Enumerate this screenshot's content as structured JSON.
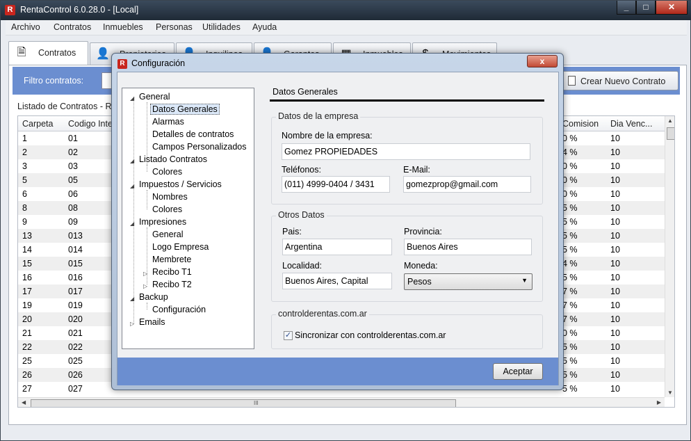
{
  "window": {
    "title": "RentaControl 6.0.28.0 - [Local]",
    "app_icon": "R"
  },
  "menu": [
    "Archivo",
    "Contratos",
    "Inmuebles",
    "Personas",
    "Utilidades",
    "Ayuda"
  ],
  "tabs": [
    {
      "label": "Contratos",
      "icon": "document-icon"
    },
    {
      "label": "Propietarios",
      "icon": "person-icon"
    },
    {
      "label": "Inquilinos",
      "icon": "person-icon"
    },
    {
      "label": "Garantes",
      "icon": "person-icon"
    },
    {
      "label": "Inmuebles",
      "icon": "building-icon"
    },
    {
      "label": "Movimientos",
      "icon": "money-icon"
    }
  ],
  "filter": {
    "label": "Filtro contratos:",
    "create_button": "Crear Nuevo Contrato"
  },
  "list": {
    "title": "Listado de Contratos - R",
    "columns": {
      "carpeta": "Carpeta",
      "codigo": "Codigo Inte",
      "comision": "Comision",
      "dia": "Dia Venc..."
    },
    "rows": [
      {
        "carpeta": "1",
        "codigo": "01",
        "comision": "0 %",
        "dia": "10"
      },
      {
        "carpeta": "2",
        "codigo": "02",
        "comision": "4 %",
        "dia": "10"
      },
      {
        "carpeta": "3",
        "codigo": "03",
        "comision": "0 %",
        "dia": "10"
      },
      {
        "carpeta": "5",
        "codigo": "05",
        "comision": "0 %",
        "dia": "10"
      },
      {
        "carpeta": "6",
        "codigo": "06",
        "comision": "0 %",
        "dia": "10"
      },
      {
        "carpeta": "8",
        "codigo": "08",
        "comision": "5 %",
        "dia": "10"
      },
      {
        "carpeta": "9",
        "codigo": "09",
        "comision": "5 %",
        "dia": "10"
      },
      {
        "carpeta": "13",
        "codigo": "013",
        "comision": "5 %",
        "dia": "10"
      },
      {
        "carpeta": "14",
        "codigo": "014",
        "comision": "5 %",
        "dia": "10"
      },
      {
        "carpeta": "15",
        "codigo": "015",
        "comision": "4 %",
        "dia": "10"
      },
      {
        "carpeta": "16",
        "codigo": "016",
        "comision": "5 %",
        "dia": "10"
      },
      {
        "carpeta": "17",
        "codigo": "017",
        "comision": "7 %",
        "dia": "10"
      },
      {
        "carpeta": "19",
        "codigo": "019",
        "comision": "7 %",
        "dia": "10"
      },
      {
        "carpeta": "20",
        "codigo": "020",
        "comision": "7 %",
        "dia": "10"
      },
      {
        "carpeta": "21",
        "codigo": "021",
        "comision": "0 %",
        "dia": "10"
      },
      {
        "carpeta": "22",
        "codigo": "022",
        "comision": "5 %",
        "dia": "10"
      },
      {
        "carpeta": "25",
        "codigo": "025",
        "comision": "5 %",
        "dia": "10"
      },
      {
        "carpeta": "26",
        "codigo": "026",
        "comision": "5 %",
        "dia": "10"
      },
      {
        "carpeta": "27",
        "codigo": "027",
        "comision": "5 %",
        "dia": "10"
      }
    ],
    "hscroll_grip": "III"
  },
  "dialog": {
    "title": "Configuración",
    "close": "x",
    "tree": {
      "general": "General",
      "datos_generales": "Datos Generales",
      "alarmas": "Alarmas",
      "detalles": "Detalles de contratos",
      "campos": "Campos Personalizados",
      "listado": "Listado Contratos",
      "colores1": "Colores",
      "impuestos": "Impuestos / Servicios",
      "nombres": "Nombres",
      "colores2": "Colores",
      "impresiones": "Impresiones",
      "general2": "General",
      "logo": "Logo Empresa",
      "membrete": "Membrete",
      "recibo1": "Recibo T1",
      "recibo2": "Recibo T2",
      "backup": "Backup",
      "configuracion": "Configuración",
      "emails": "Emails"
    },
    "section_title": "Datos Generales",
    "empresa": {
      "group": "Datos de la empresa",
      "nombre_label": "Nombre de la empresa:",
      "nombre_value": "Gomez PROPIEDADES",
      "telefonos_label": "Teléfonos:",
      "telefonos_value": "(011) 4999-0404 / 3431",
      "email_label": "E-Mail:",
      "email_value": "gomezprop@gmail.com"
    },
    "otros": {
      "group": "Otros Datos",
      "pais_label": "Pais:",
      "pais_value": "Argentina",
      "provincia_label": "Provincia:",
      "provincia_value": "Buenos Aires",
      "localidad_label": "Localidad:",
      "localidad_value": "Buenos Aires, Capital",
      "moneda_label": "Moneda:",
      "moneda_value": "Pesos"
    },
    "sync": {
      "group": "controlderentas.com.ar",
      "checkbox_label": "Sincronizar con controlderentas.com.ar",
      "checked": true
    },
    "accept_button": "Aceptar"
  }
}
